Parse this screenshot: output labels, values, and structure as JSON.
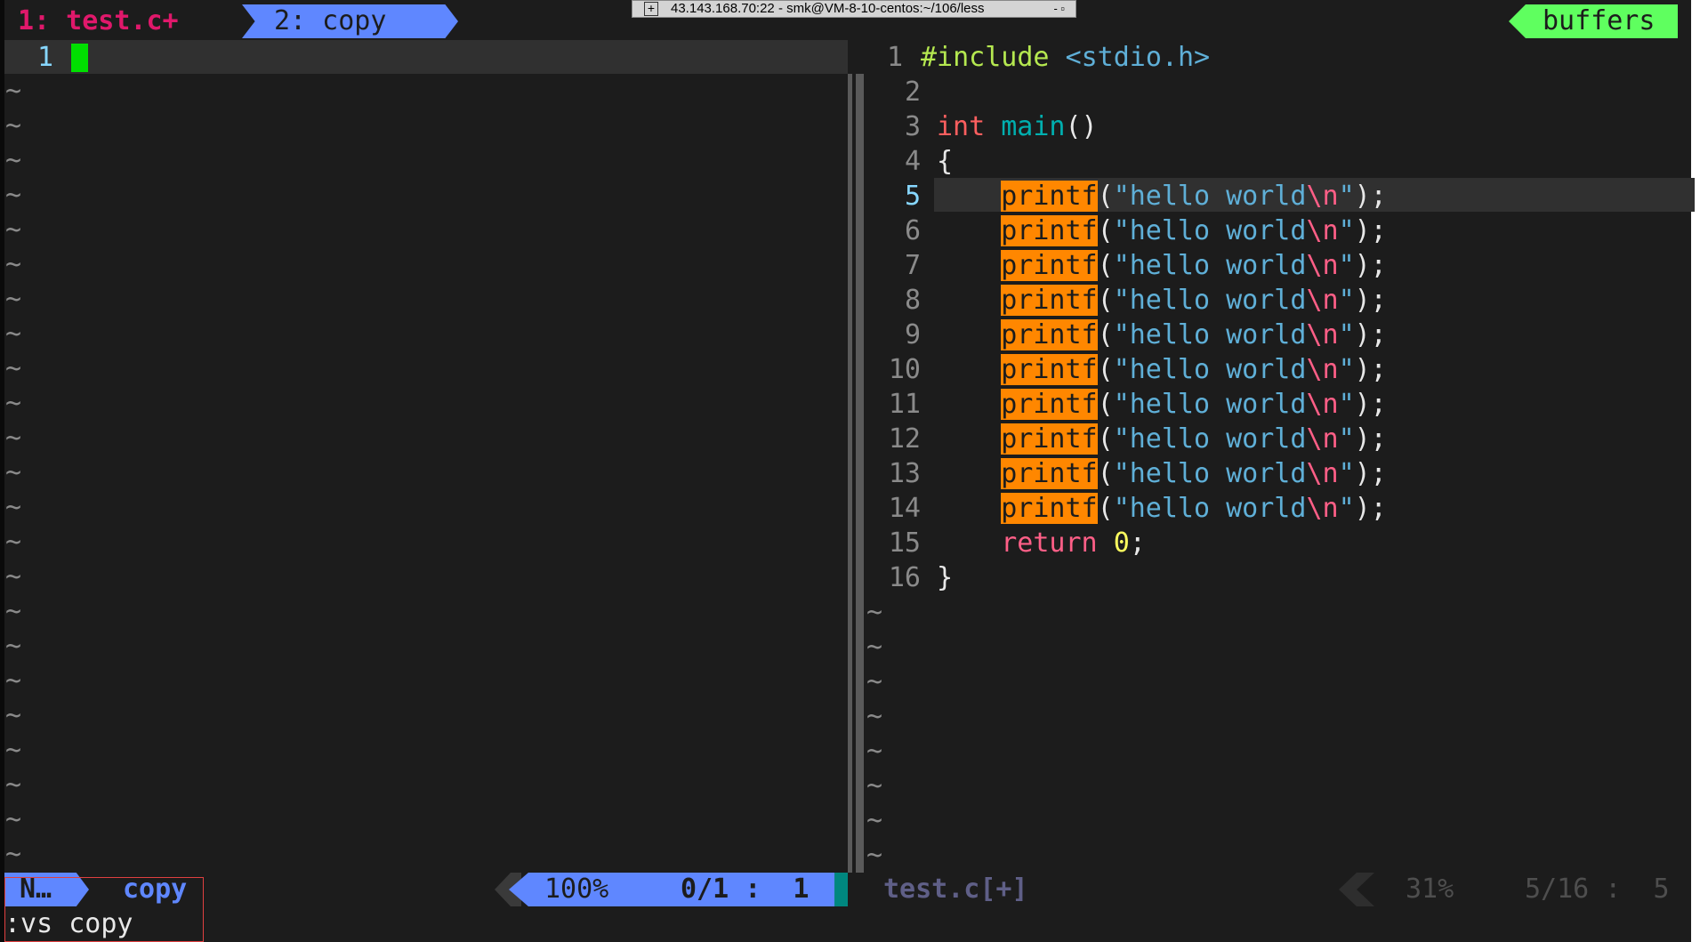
{
  "tabs": [
    {
      "label": "1: test.c+",
      "active": true
    },
    {
      "label": "2: copy",
      "active": false
    }
  ],
  "buffers_label": "buffers",
  "titlebar": {
    "title": "43.143.168.70:22 - smk@VM-8-10-centos:~/106/less",
    "controls": "- ▫"
  },
  "left_pane": {
    "line_number": "1",
    "tilde": "~",
    "tilde_count": 23
  },
  "right_pane": {
    "lines": [
      {
        "n": "1",
        "parts": [
          {
            "t": "#include ",
            "c": "kw-inc"
          },
          {
            "t": "<stdio.h>",
            "c": "str-lt"
          }
        ],
        "indent": 0,
        "nw": 30
      },
      {
        "n": "2",
        "parts": [],
        "indent": 0
      },
      {
        "n": "3",
        "parts": [
          {
            "t": "int",
            "c": "kw-int"
          },
          {
            "t": " ",
            "c": "punc"
          },
          {
            "t": "main",
            "c": "fn"
          },
          {
            "t": "()",
            "c": "punc"
          }
        ],
        "indent": 0
      },
      {
        "n": "4",
        "parts": [
          {
            "t": "{",
            "c": "punc"
          }
        ],
        "indent": 0
      },
      {
        "n": "5",
        "cur": true,
        "parts": [
          {
            "t": "    ",
            "c": "punc"
          },
          {
            "t": "printf",
            "c": "hl"
          },
          {
            "t": "(",
            "c": "punc"
          },
          {
            "t": "\"hello world",
            "c": "str"
          },
          {
            "t": "\\n",
            "c": "esc"
          },
          {
            "t": "\"",
            "c": "str"
          },
          {
            "t": ");",
            "c": "punc"
          }
        ]
      },
      {
        "n": "6",
        "parts": [
          {
            "t": "    ",
            "c": "punc"
          },
          {
            "t": "printf",
            "c": "hl"
          },
          {
            "t": "(",
            "c": "punc"
          },
          {
            "t": "\"hello world",
            "c": "str"
          },
          {
            "t": "\\n",
            "c": "esc"
          },
          {
            "t": "\"",
            "c": "str"
          },
          {
            "t": ");",
            "c": "punc"
          }
        ]
      },
      {
        "n": "7",
        "parts": [
          {
            "t": "    ",
            "c": "punc"
          },
          {
            "t": "printf",
            "c": "hl"
          },
          {
            "t": "(",
            "c": "punc"
          },
          {
            "t": "\"hello world",
            "c": "str"
          },
          {
            "t": "\\n",
            "c": "esc"
          },
          {
            "t": "\"",
            "c": "str"
          },
          {
            "t": ");",
            "c": "punc"
          }
        ]
      },
      {
        "n": "8",
        "parts": [
          {
            "t": "    ",
            "c": "punc"
          },
          {
            "t": "printf",
            "c": "hl"
          },
          {
            "t": "(",
            "c": "punc"
          },
          {
            "t": "\"hello world",
            "c": "str"
          },
          {
            "t": "\\n",
            "c": "esc"
          },
          {
            "t": "\"",
            "c": "str"
          },
          {
            "t": ");",
            "c": "punc"
          }
        ]
      },
      {
        "n": "9",
        "parts": [
          {
            "t": "    ",
            "c": "punc"
          },
          {
            "t": "printf",
            "c": "hl"
          },
          {
            "t": "(",
            "c": "punc"
          },
          {
            "t": "\"hello world",
            "c": "str"
          },
          {
            "t": "\\n",
            "c": "esc"
          },
          {
            "t": "\"",
            "c": "str"
          },
          {
            "t": ");",
            "c": "punc"
          }
        ]
      },
      {
        "n": "10",
        "parts": [
          {
            "t": "    ",
            "c": "punc"
          },
          {
            "t": "printf",
            "c": "hl"
          },
          {
            "t": "(",
            "c": "punc"
          },
          {
            "t": "\"hello world",
            "c": "str"
          },
          {
            "t": "\\n",
            "c": "esc"
          },
          {
            "t": "\"",
            "c": "str"
          },
          {
            "t": ");",
            "c": "punc"
          }
        ]
      },
      {
        "n": "11",
        "parts": [
          {
            "t": "    ",
            "c": "punc"
          },
          {
            "t": "printf",
            "c": "hl"
          },
          {
            "t": "(",
            "c": "punc"
          },
          {
            "t": "\"hello world",
            "c": "str"
          },
          {
            "t": "\\n",
            "c": "esc"
          },
          {
            "t": "\"",
            "c": "str"
          },
          {
            "t": ");",
            "c": "punc"
          }
        ]
      },
      {
        "n": "12",
        "parts": [
          {
            "t": "    ",
            "c": "punc"
          },
          {
            "t": "printf",
            "c": "hl"
          },
          {
            "t": "(",
            "c": "punc"
          },
          {
            "t": "\"hello world",
            "c": "str"
          },
          {
            "t": "\\n",
            "c": "esc"
          },
          {
            "t": "\"",
            "c": "str"
          },
          {
            "t": ");",
            "c": "punc"
          }
        ]
      },
      {
        "n": "13",
        "parts": [
          {
            "t": "    ",
            "c": "punc"
          },
          {
            "t": "printf",
            "c": "hl"
          },
          {
            "t": "(",
            "c": "punc"
          },
          {
            "t": "\"hello world",
            "c": "str"
          },
          {
            "t": "\\n",
            "c": "esc"
          },
          {
            "t": "\"",
            "c": "str"
          },
          {
            "t": ");",
            "c": "punc"
          }
        ]
      },
      {
        "n": "14",
        "parts": [
          {
            "t": "    ",
            "c": "punc"
          },
          {
            "t": "printf",
            "c": "hl"
          },
          {
            "t": "(",
            "c": "punc"
          },
          {
            "t": "\"hello world",
            "c": "str"
          },
          {
            "t": "\\n",
            "c": "esc"
          },
          {
            "t": "\"",
            "c": "str"
          },
          {
            "t": ");",
            "c": "punc"
          }
        ]
      },
      {
        "n": "15",
        "parts": [
          {
            "t": "    ",
            "c": "punc"
          },
          {
            "t": "return",
            "c": "kw-ret"
          },
          {
            "t": " ",
            "c": "punc"
          },
          {
            "t": "0",
            "c": "numlit"
          },
          {
            "t": ";",
            "c": "punc"
          }
        ]
      },
      {
        "n": "16",
        "parts": [
          {
            "t": "}",
            "c": "punc"
          }
        ]
      }
    ],
    "tilde": "~",
    "tilde_count": 8
  },
  "status_left": {
    "mode": "N…",
    "buffer": "copy",
    "percent": "100%",
    "position": "0/1 :  1"
  },
  "status_right": {
    "buffer": "test.c[+]",
    "percent": "31%",
    "position": "5/16 :  5"
  },
  "command_line": ":vs copy",
  "colors": {
    "background": "#1c1c1c",
    "accent_blue": "#5f87ff",
    "accent_green": "#5fff5f",
    "highlight_orange": "#ff8700",
    "tab_active": "#e0186b"
  }
}
